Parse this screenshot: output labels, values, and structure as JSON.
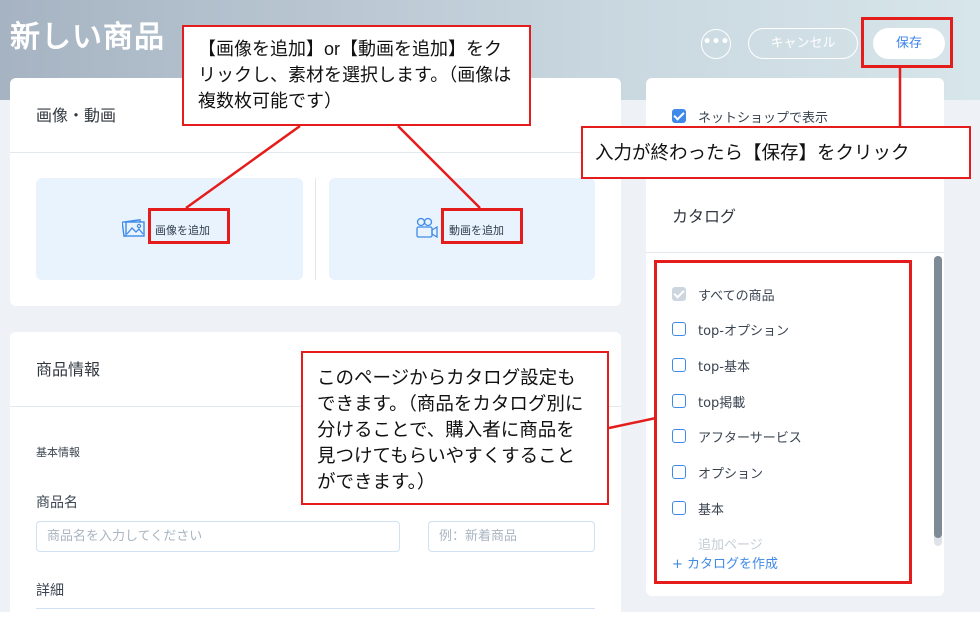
{
  "header": {
    "title": "新しい商品",
    "more_label": "•••",
    "cancel_label": "キャンセル",
    "save_label": "保存"
  },
  "media_card": {
    "title": "画像・動画",
    "add_image_label": "画像を追加",
    "add_video_label": "動画を追加",
    "image_icon": "image-icon",
    "video_icon": "video-camera-icon"
  },
  "info_card": {
    "title": "商品情報",
    "section_label": "基本情報",
    "name_label": "商品名",
    "name_placeholder": "商品名を入力してください",
    "ribbon_placeholder": "例：新着商品",
    "detail_label": "詳細"
  },
  "sidebar": {
    "show_in_shop_label": "ネットショップで表示",
    "catalog_title": "カタログ",
    "catalogs": [
      {
        "label": "すべての商品",
        "checked": true,
        "disabled": true
      },
      {
        "label": "top-オプション",
        "checked": false
      },
      {
        "label": "top-基本",
        "checked": false
      },
      {
        "label": "top掲載",
        "checked": false
      },
      {
        "label": "アフターサービス",
        "checked": false
      },
      {
        "label": "オプション",
        "checked": false
      },
      {
        "label": "基本",
        "checked": false
      },
      {
        "label": "追加ページ",
        "checked": false
      }
    ],
    "create_catalog_label": "+ カタログを作成"
  },
  "annotations": {
    "media_note": "【画像を追加】or【動画を追加】をクリックし、素材を選択します。（画像は複数枚可能です）",
    "save_note": "入力が終わったら【保存】をクリック",
    "catalog_note": "このページからカタログ設定もできます。（商品をカタログ別に分けることで、購入者に商品を見つけてもらいやすくすることができます。）"
  },
  "colors": {
    "accent": "#3f8ae8",
    "annotation_red": "#e51c1c",
    "media_box": "#e8f3fe"
  }
}
